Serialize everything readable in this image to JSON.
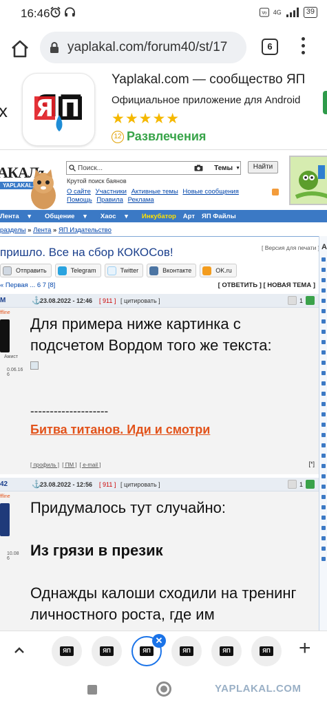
{
  "status": {
    "time": "16:46",
    "network": "4G",
    "battery": "39"
  },
  "browser": {
    "url": "yaplakal.com/forum40/st/17",
    "tab_count": "6"
  },
  "app_banner": {
    "close": "x",
    "logo_text": "ЯП",
    "title": "Yaplakal.com — сообщество ЯП",
    "subtitle": "Официальное приложение для Android",
    "rating_stars": 5,
    "age": "12",
    "category": "Развлечения"
  },
  "site": {
    "brand": "АКАЛъ",
    "brand_sub": "YAPLAKAL.COM",
    "search_placeholder": "Поиск...",
    "search_scope": "Темы",
    "search_button": "Найти",
    "search_hint": "Крутой поиск баянов",
    "links_row1": [
      "О сайте",
      "Участники",
      "Активные темы",
      "Новые сообщения"
    ],
    "links_row2": [
      "Помощь",
      "Правила",
      "Реклама"
    ],
    "nav": [
      "Лента",
      "Общение",
      "Хаос",
      "Инкубатор",
      "Арт",
      "ЯП Файлы"
    ],
    "nav_arrow": "▾",
    "breadcrumbs": [
      "разделы",
      "Лента",
      "ЯП Издательство"
    ],
    "breadcrumb_sep": "»"
  },
  "topic": {
    "title": "пришло. Все на сбор КОКОСов!",
    "print_version": "[ Версия для печати ]",
    "share": [
      "Отправить",
      "Telegram",
      "Twitter",
      "Вконтакте",
      "OK.ru"
    ],
    "pagination": "« Первая ... 6 7 [8]",
    "actions": "[ ОТВЕТИТЬ ] [ НОВАЯ ТЕМА ]"
  },
  "posts": [
    {
      "nick": "М",
      "date": "23.08.2022 - 12:46",
      "num": "[ 911 ]",
      "quote": "[ цитировать ]",
      "rating": "1",
      "status": "ffline",
      "side_text": "Амист",
      "side_date": "0.06.16",
      "side_num": "6",
      "paragraphs": [
        "Для примера ниже картинка с подсчетом Вордом того же текста:"
      ],
      "separator": "--------------------",
      "link": "Битва титанов. Иди и смотри",
      "footer": [
        "[ профиль ]",
        "[ ПМ ]",
        "[ e-mail ]"
      ],
      "footer_right": "[*]"
    },
    {
      "nick": "42",
      "date": "23.08.2022 - 12:56",
      "num": "[ 911 ]",
      "quote": "[ цитировать ]",
      "rating": "1",
      "status": "ffline",
      "side_date": "10.08",
      "side_num": "6",
      "paragraphs": [
        "Придумалось тут случайно:",
        "Из грязи в презик",
        "Однажды калоши сходили на тренинг личностного роста, где им"
      ]
    }
  ],
  "sidebar": {
    "letter": "А"
  },
  "tab_strip": {
    "thumb_label": "ЯП",
    "close_badge": "✕",
    "new_tab": "+"
  },
  "watermark": "YAPLAKAL.COM",
  "colors": {
    "nav_bg": "#3b79c5",
    "highlight": "#ffe100",
    "link": "#0044aa",
    "post_link": "#e2531b",
    "star": "#f5b800",
    "category": "#38a449",
    "accent": "#1a73e8"
  }
}
